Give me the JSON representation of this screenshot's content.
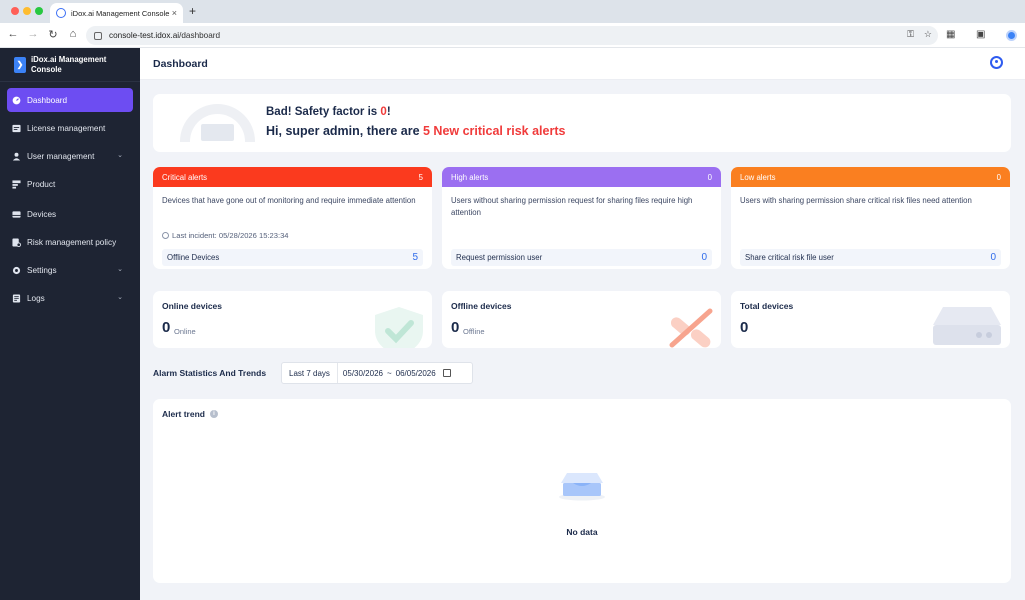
{
  "browser": {
    "tab_title": "iDox.ai Management Console",
    "tab_close": "×",
    "new_tab": "+",
    "url_host": "console-test.idox.ai",
    "url_path": "/dashboard"
  },
  "sidebar": {
    "brand": "iDox.ai Management Console",
    "items": [
      {
        "label": "Dashboard",
        "icon": "gauge-icon",
        "active": true
      },
      {
        "label": "License management",
        "icon": "license-icon"
      },
      {
        "label": "User management",
        "icon": "users-icon",
        "expandable": true
      },
      {
        "label": "Product",
        "icon": "product-icon"
      },
      {
        "label": "Devices",
        "icon": "devices-icon"
      },
      {
        "label": "Risk management policy",
        "icon": "policy-icon"
      },
      {
        "label": "Settings",
        "icon": "gear-icon",
        "expandable": true
      },
      {
        "label": "Logs",
        "icon": "logs-icon",
        "expandable": true
      }
    ]
  },
  "header": {
    "title": "Dashboard"
  },
  "safety": {
    "prefix": "Bad! Safety factor is ",
    "factor": "0",
    "suffix": "!",
    "greeting": "Hi, super admin, there are ",
    "alert_count_text": "5 New critical risk alerts"
  },
  "alerts": [
    {
      "title": "Critical alerts",
      "count": "5",
      "color": "#fb3a1e",
      "desc": "Devices that have gone out of monitoring and require immediate attention",
      "last": "Last incident: 05/28/2026 15:23:34",
      "footer_label": "Offline Devices",
      "footer_value": "5"
    },
    {
      "title": "High alerts",
      "count": "0",
      "color": "#9b6ff1",
      "desc": "Users without sharing permission request for sharing files require high attention",
      "footer_label": "Request permission user",
      "footer_value": "0"
    },
    {
      "title": "Low alerts",
      "count": "0",
      "color": "#fa7f20",
      "desc": "Users with sharing permission share critical risk files need attention",
      "footer_label": "Share critical risk file user",
      "footer_value": "0"
    }
  ],
  "devices": [
    {
      "title": "Online devices",
      "value": "0",
      "sub": "Online"
    },
    {
      "title": "Offline devices",
      "value": "0",
      "sub": "Offline"
    },
    {
      "title": "Total devices",
      "value": "0",
      "sub": ""
    }
  ],
  "stats": {
    "title": "Alarm Statistics And Trends",
    "preset": "Last 7 days",
    "start": "05/30/2026",
    "separator": "~",
    "end": "06/05/2026"
  },
  "trend": {
    "title": "Alert trend",
    "info": "i",
    "empty": "No data"
  }
}
